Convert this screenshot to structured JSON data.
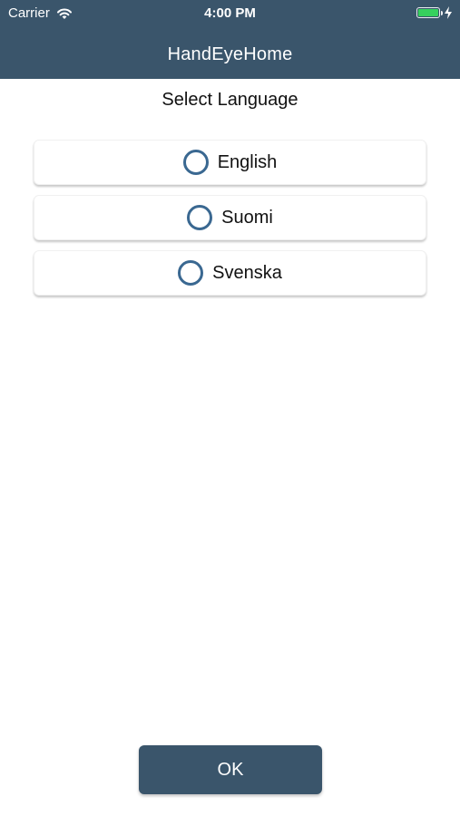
{
  "status_bar": {
    "carrier": "Carrier",
    "time": "4:00 PM",
    "battery_color": "#36d05e",
    "icons": [
      "wifi-icon",
      "battery-icon",
      "charging-bolt-icon"
    ]
  },
  "nav": {
    "title": "HandEyeHome",
    "background_color": "#3a556b"
  },
  "main": {
    "title": "Select Language",
    "languages": [
      {
        "label": "English",
        "selected": false
      },
      {
        "label": "Suomi",
        "selected": false
      },
      {
        "label": "Svenska",
        "selected": false
      }
    ],
    "radio_color": "#3a6891"
  },
  "footer": {
    "ok_label": "OK"
  }
}
